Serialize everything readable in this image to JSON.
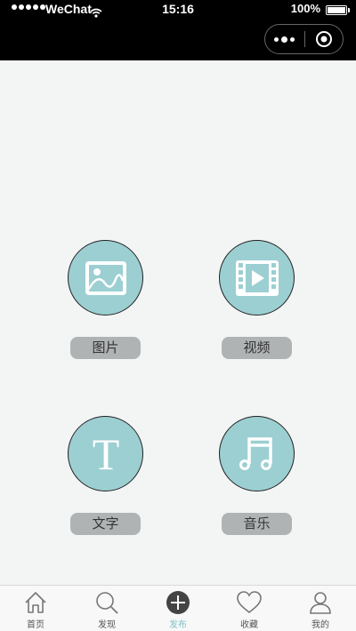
{
  "status_bar": {
    "carrier": "WeChat",
    "time": "15:16",
    "battery": "100%"
  },
  "capsule": {
    "more_icon": "more-dots-icon",
    "close_icon": "target-close-icon"
  },
  "post_options": [
    {
      "label": "图片",
      "icon": "image-icon"
    },
    {
      "label": "视频",
      "icon": "video-icon"
    },
    {
      "label": "文字",
      "icon": "text-icon"
    },
    {
      "label": "音乐",
      "icon": "music-icon"
    }
  ],
  "tabs": [
    {
      "label": "首页",
      "icon": "home-icon",
      "active": false
    },
    {
      "label": "发现",
      "icon": "search-icon",
      "active": false
    },
    {
      "label": "发布",
      "icon": "plus-icon",
      "active": true
    },
    {
      "label": "收藏",
      "icon": "heart-icon",
      "active": false
    },
    {
      "label": "我的",
      "icon": "user-icon",
      "active": false
    }
  ],
  "colors": {
    "accent": "#9ccfd2",
    "active_tab": "#7fc3c7",
    "label_bg": "#b0b3b4",
    "background": "#f3f5f5"
  }
}
